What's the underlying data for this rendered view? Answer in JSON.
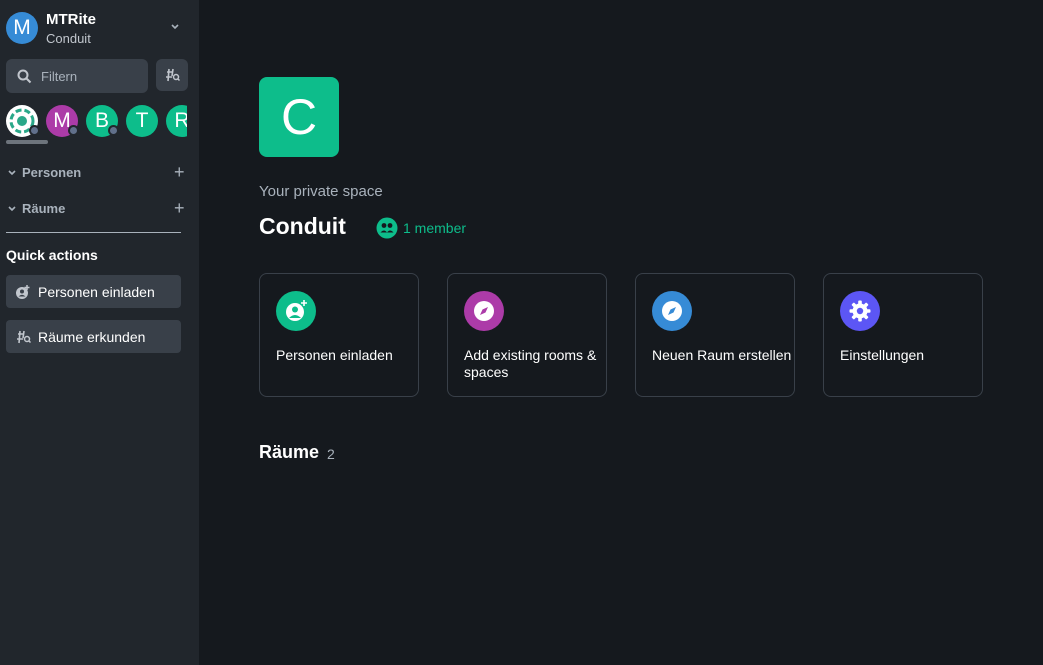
{
  "sidebar": {
    "header": {
      "avatar_letter": "M",
      "title": "MTRite",
      "subtitle": "Conduit"
    },
    "filter": {
      "placeholder": "Filtern"
    },
    "spaces": [
      {
        "letter": "",
        "color": "#ffffff",
        "icon": "ring-logo-icon"
      },
      {
        "letter": "M",
        "color": "#ac3ba8"
      },
      {
        "letter": "B",
        "color": "#0dbd8b"
      },
      {
        "letter": "T",
        "color": "#0dbd8b"
      },
      {
        "letter": "R",
        "color": "#0dbd8b"
      }
    ],
    "sections": [
      {
        "label": "Personen"
      },
      {
        "label": "Räume"
      }
    ],
    "quick_actions": {
      "title": "Quick actions",
      "invite_label": "Personen einladen",
      "explore_label": "Räume erkunden"
    }
  },
  "main": {
    "avatar_letter": "C",
    "private_label": "Your private space",
    "title": "Conduit",
    "members_label": "1 member",
    "cards": [
      {
        "label": "Personen einladen",
        "color": "#0dbd8b",
        "icon": "invite-person-icon"
      },
      {
        "label": "Add existing rooms & spaces",
        "color": "#ac3ba8",
        "icon": "compass-icon"
      },
      {
        "label": "Neuen Raum erstellen",
        "color": "#368bd6",
        "icon": "compass-icon"
      },
      {
        "label": "Einstellungen",
        "color": "#5c56f5",
        "icon": "gear-icon"
      }
    ],
    "rooms": {
      "title": "Räume",
      "count": "2"
    }
  },
  "colors": {
    "accent": "#0dbd8b",
    "sidebar_bg": "#21262c",
    "main_bg": "#15191e"
  }
}
